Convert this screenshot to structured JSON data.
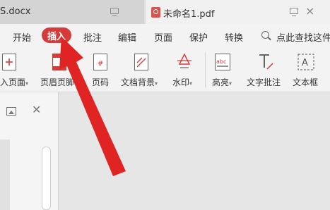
{
  "tabs": [
    {
      "label": "S.docx",
      "active": false
    },
    {
      "label": "未命名1.pdf",
      "active": true
    }
  ],
  "menu": {
    "items": [
      "开始",
      "插入",
      "批注",
      "编辑",
      "页面",
      "保护",
      "转换"
    ],
    "active": "插入",
    "search_label": "点此查找这件"
  },
  "toolbar": {
    "items": [
      {
        "label": "入页面",
        "icon": "insert-page-icon",
        "dropdown": true
      },
      {
        "label": "页眉页脚",
        "icon": "header-footer-icon",
        "dropdown": false
      },
      {
        "label": "页码",
        "icon": "page-number-icon",
        "dropdown": false
      },
      {
        "label": "文档背景",
        "icon": "document-background-icon",
        "dropdown": true
      },
      {
        "label": "水印",
        "icon": "watermark-icon",
        "dropdown": true
      },
      {
        "label": "高亮",
        "icon": "highlight-icon",
        "dropdown": true
      },
      {
        "label": "文字批注",
        "icon": "text-annotation-icon",
        "dropdown": false
      },
      {
        "label": "文本框",
        "icon": "text-box-icon",
        "dropdown": false
      }
    ]
  },
  "colors": {
    "accent": "#d63b3b",
    "arrow": "#e02424"
  }
}
